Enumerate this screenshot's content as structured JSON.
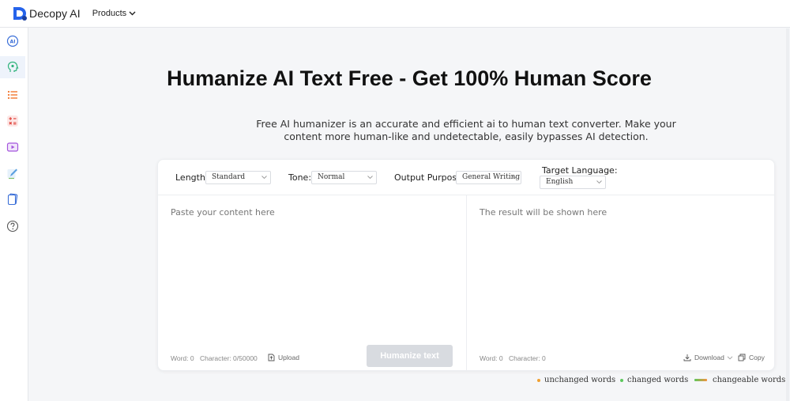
{
  "header": {
    "brand": "Decopy AI",
    "products_label": "Products"
  },
  "colors": {
    "brand_blue": "#2563eb",
    "unchanged": "#f0a030",
    "changed": "#5cc85c",
    "changeable": "#f5913e"
  },
  "sidebar": {
    "items": [
      {
        "icon": "ai-detector-icon"
      },
      {
        "icon": "ai-humanizer-icon"
      },
      {
        "icon": "list-icon"
      },
      {
        "icon": "math-icon"
      },
      {
        "icon": "video-icon"
      },
      {
        "icon": "edit-icon"
      },
      {
        "icon": "cards-icon"
      },
      {
        "icon": "help-icon"
      }
    ]
  },
  "main": {
    "title": "Humanize AI Text Free - Get 100% Human Score",
    "subtitle": "Free AI humanizer is an accurate and efficient ai to human text converter. Make your content more human-like and undetectable, easily bypasses AI detection."
  },
  "options": {
    "length_label": "Length:",
    "length_value": "Standard",
    "tone_label": "Tone:",
    "tone_value": "Normal",
    "purpose_label": "Output Purpose:",
    "purpose_value": "General Writing",
    "language_label": "Target Language:",
    "language_value": "English"
  },
  "input": {
    "placeholder": "Paste your content here",
    "word_count": "Word: 0",
    "char_count": "Character: 0/50000",
    "upload_label": "Upload",
    "humanize_label": "Humanize text"
  },
  "output": {
    "placeholder": "The result will be shown here",
    "word_count": "Word: 0",
    "char_count": "Character: 0",
    "download_label": "Download",
    "copy_label": "Copy"
  },
  "legend": {
    "unchanged": "unchanged words",
    "changed": "changed words",
    "changeable": "changeable words"
  }
}
